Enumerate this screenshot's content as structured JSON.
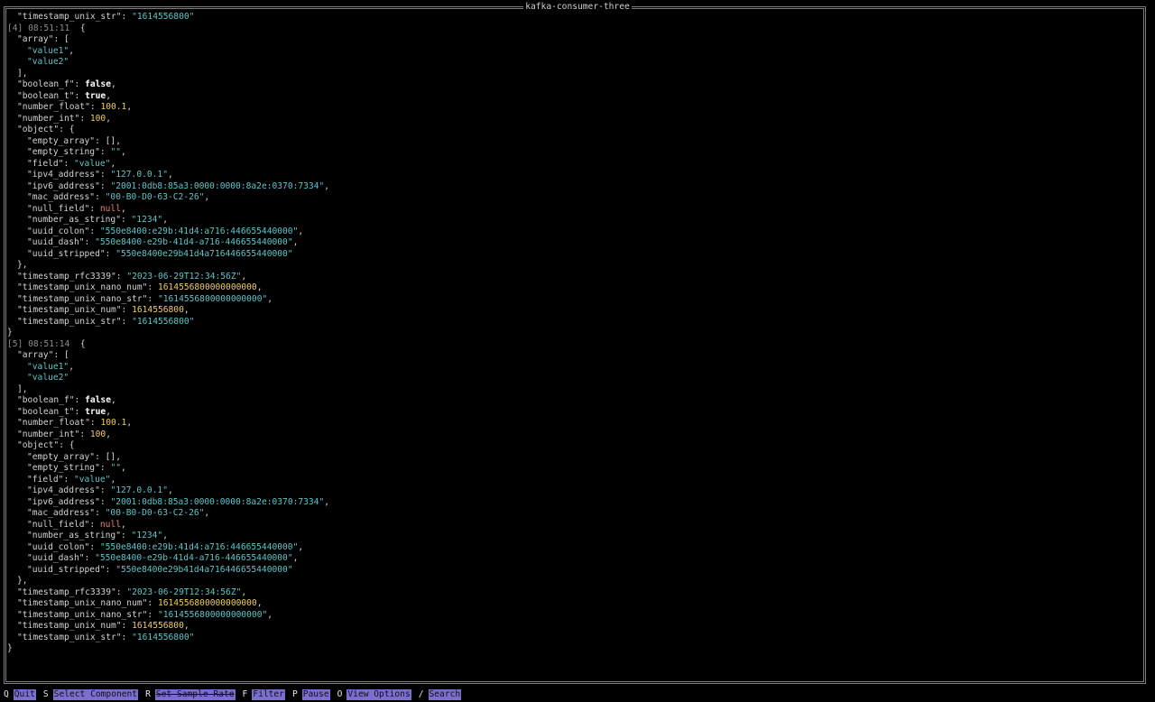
{
  "window": {
    "title": "kafka-consumer-three"
  },
  "top_partial": {
    "key": "\"timestamp_unix_str\"",
    "value": "\"1614556800\""
  },
  "messages": [
    {
      "index": "[4]",
      "time": "08:51:11",
      "array_items": [
        "\"value1\"",
        "\"value2\""
      ],
      "boolean_f": "false",
      "boolean_t": "true",
      "number_float": "100.1",
      "number_int": "100",
      "object": {
        "empty_array": "[]",
        "empty_string": "\"\"",
        "field": "\"value\"",
        "ipv4_address": "\"127.0.0.1\"",
        "ipv6_address": "\"2001:0db8:85a3:0000:0000:8a2e:0370:7334\"",
        "mac_address": "\"00-B0-D0-63-C2-26\"",
        "null_field": "null",
        "number_as_string": "\"1234\"",
        "uuid_colon": "\"550e8400:e29b:41d4:a716:446655440000\"",
        "uuid_dash": "\"550e8400-e29b-41d4-a716-446655440000\"",
        "uuid_stripped": "\"550e8400e29b41d4a716446655440000\""
      },
      "timestamp_rfc3339": "\"2023-06-29T12:34:56Z\"",
      "timestamp_unix_nano_num": "1614556800000000000",
      "timestamp_unix_nano_str": "\"1614556800000000000\"",
      "timestamp_unix_num": "1614556800",
      "timestamp_unix_str": "\"1614556800\""
    },
    {
      "index": "[5]",
      "time": "08:51:14",
      "array_items": [
        "\"value1\"",
        "\"value2\""
      ],
      "boolean_f": "false",
      "boolean_t": "true",
      "number_float": "100.1",
      "number_int": "100",
      "object": {
        "empty_array": "[]",
        "empty_string": "\"\"",
        "field": "\"value\"",
        "ipv4_address": "\"127.0.0.1\"",
        "ipv6_address": "\"2001:0db8:85a3:0000:0000:8a2e:0370:7334\"",
        "mac_address": "\"00-B0-D0-63-C2-26\"",
        "null_field": "null",
        "number_as_string": "\"1234\"",
        "uuid_colon": "\"550e8400:e29b:41d4:a716:446655440000\"",
        "uuid_dash": "\"550e8400-e29b-41d4-a716-446655440000\"",
        "uuid_stripped": "\"550e8400e29b41d4a716446655440000\""
      },
      "timestamp_rfc3339": "\"2023-06-29T12:34:56Z\"",
      "timestamp_unix_nano_num": "1614556800000000000",
      "timestamp_unix_nano_str": "\"1614556800000000000\"",
      "timestamp_unix_num": "1614556800",
      "timestamp_unix_str": "\"1614556800\""
    }
  ],
  "footer": [
    {
      "key": "Q",
      "label": "Quit",
      "struck": false
    },
    {
      "key": "S",
      "label": "Select Component",
      "struck": false
    },
    {
      "key": "R",
      "label": "Set Sample Rate",
      "struck": true
    },
    {
      "key": "F",
      "label": "Filter",
      "struck": false
    },
    {
      "key": "P",
      "label": "Pause",
      "struck": false
    },
    {
      "key": "O",
      "label": "View Options",
      "struck": false
    },
    {
      "key": "/",
      "label": "Search",
      "struck": false
    }
  ]
}
